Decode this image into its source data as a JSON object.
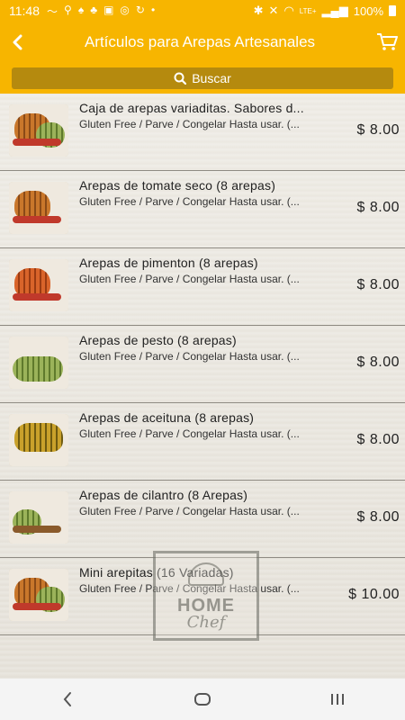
{
  "status_bar": {
    "time": "11:48",
    "battery": "100%",
    "network": "LTE+"
  },
  "app_bar": {
    "title": "Artículos para Arepas Artesanales",
    "back_icon": "chevron-left-icon",
    "cart_icon": "cart-icon"
  },
  "search": {
    "label": "Buscar",
    "icon": "search-icon"
  },
  "products": [
    {
      "name": "Caja de arepas variaditas. Sabores d...",
      "description": "Gluten Free / Parve / Congelar Hasta usar. (...",
      "price": "$ 8.00"
    },
    {
      "name": "Arepas de tomate seco (8 arepas)",
      "description": "Gluten Free / Parve / Congelar Hasta usar. (...",
      "price": "$ 8.00"
    },
    {
      "name": "Arepas de pimenton (8 arepas)",
      "description": "Gluten Free / Parve / Congelar Hasta usar. (...",
      "price": "$ 8.00"
    },
    {
      "name": "Arepas de pesto (8 arepas)",
      "description": "Gluten Free / Parve / Congelar Hasta usar. (...",
      "price": "$ 8.00"
    },
    {
      "name": "Arepas de aceituna (8 arepas)",
      "description": "Gluten Free / Parve / Congelar Hasta usar. (...",
      "price": "$ 8.00"
    },
    {
      "name": "Arepas de cilantro (8 Arepas)",
      "description": "Gluten Free / Parve / Congelar Hasta usar. (...",
      "price": "$ 8.00"
    },
    {
      "name": "Mini arepitas (16 Variadas)",
      "description": "Gluten Free / Parve / Congelar Hasta usar. (...",
      "price": "$ 10.00"
    }
  ],
  "watermark": {
    "line1": "HOME",
    "line2": "Chef"
  },
  "colors": {
    "accent": "#f7b500",
    "search_bg": "#b58a0e"
  }
}
